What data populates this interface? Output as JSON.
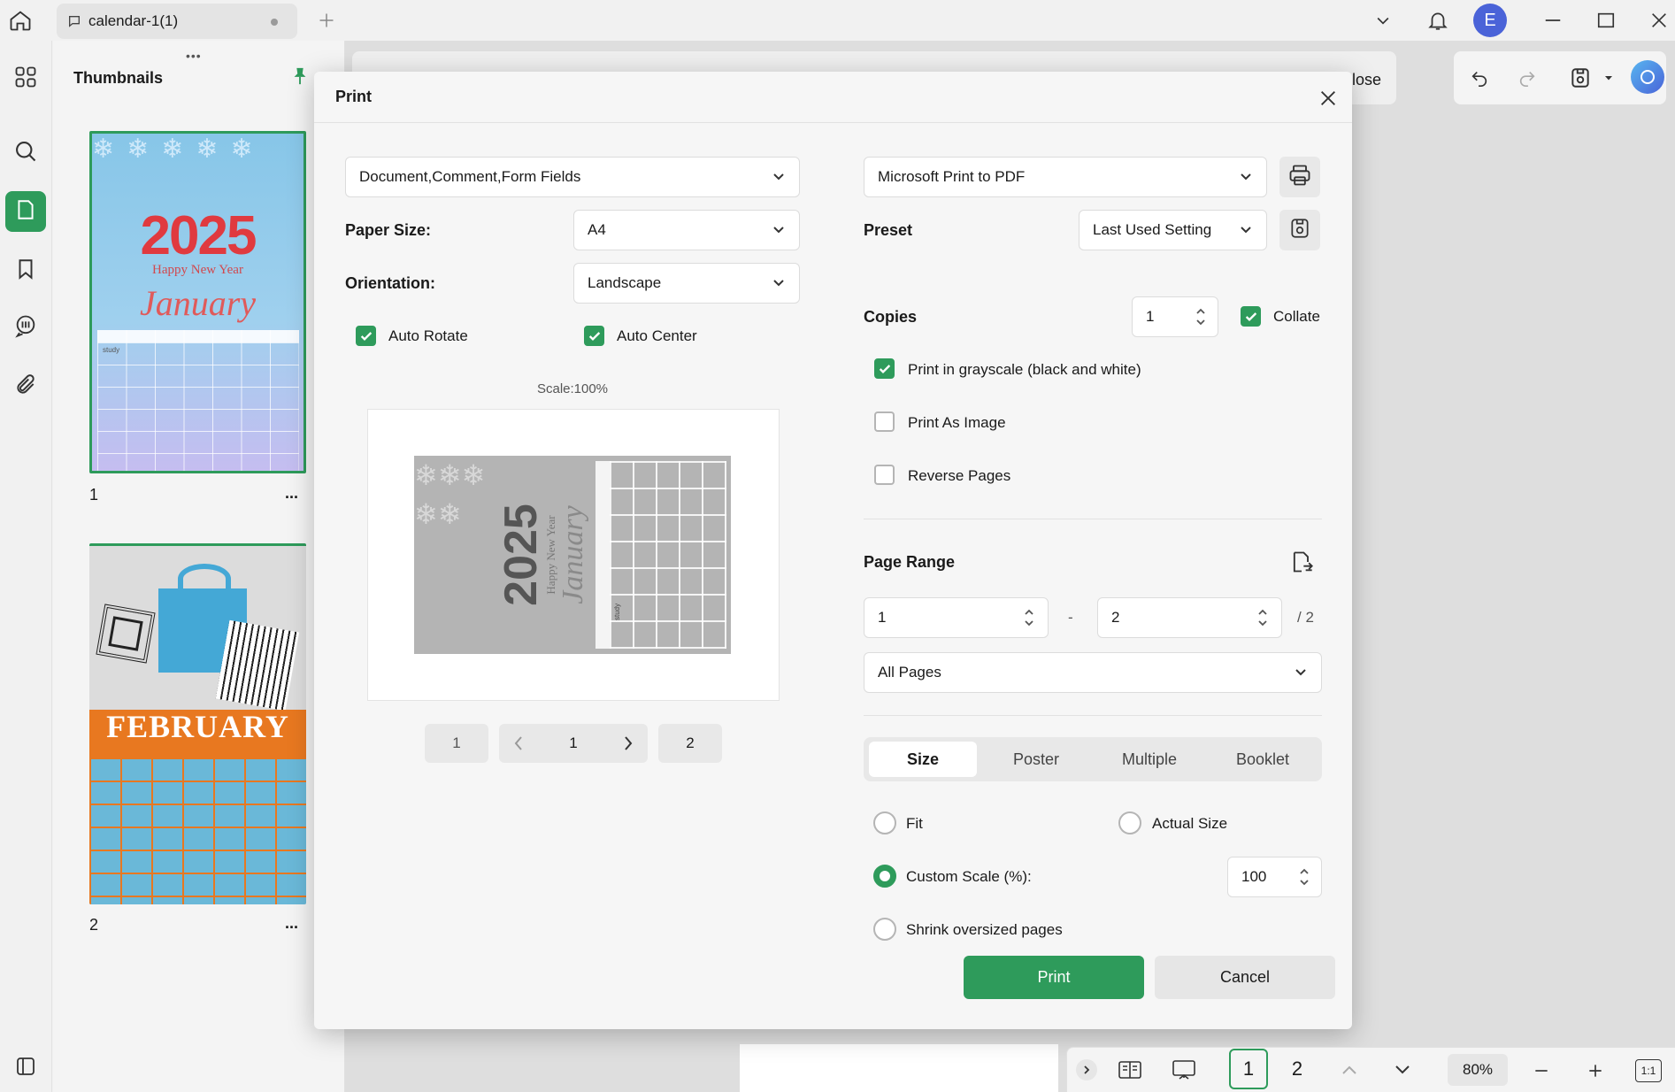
{
  "tab": {
    "title": "calendar-1(1)"
  },
  "user": {
    "avatar_letter": "E"
  },
  "thumbnails": {
    "title": "Thumbnails",
    "pages": [
      {
        "number": "1",
        "year": "2025",
        "greeting": "Happy New Year",
        "month": "January",
        "note": "study"
      },
      {
        "number": "2",
        "month": "FEBRUARY"
      }
    ],
    "more_label": "..."
  },
  "toolbar": {
    "close_partial": "lose"
  },
  "dialog": {
    "title": "Print",
    "content_select": "Document,Comment,Form Fields",
    "printer_select": "Microsoft Print to PDF",
    "paper_size": {
      "label": "Paper Size:",
      "value": "A4"
    },
    "orientation": {
      "label": "Orientation:",
      "value": "Landscape"
    },
    "auto_rotate": {
      "label": "Auto Rotate",
      "checked": true
    },
    "auto_center": {
      "label": "Auto Center",
      "checked": true
    },
    "scale_label": "Scale:100%",
    "preview": {
      "year": "2025",
      "greeting": "Happy New Year",
      "month": "January",
      "note": "study"
    },
    "pager": {
      "first": "1",
      "current": "1",
      "last": "2"
    },
    "preset": {
      "label": "Preset",
      "value": "Last Used Setting"
    },
    "copies": {
      "label": "Copies",
      "value": "1",
      "collate_label": "Collate",
      "collate_checked": true
    },
    "grayscale": {
      "label": "Print in grayscale (black and white)",
      "checked": true
    },
    "print_as_image": {
      "label": "Print As Image",
      "checked": false
    },
    "reverse_pages": {
      "label": "Reverse Pages",
      "checked": false
    },
    "page_range": {
      "label": "Page Range",
      "from": "1",
      "separator": "-",
      "to": "2",
      "total": "/ 2",
      "select": "All Pages"
    },
    "tabs": [
      "Size",
      "Poster",
      "Multiple",
      "Booklet"
    ],
    "active_tab": "Size",
    "size_options": {
      "fit": "Fit",
      "actual": "Actual Size",
      "custom": "Custom Scale (%):",
      "custom_value": "100",
      "shrink": "Shrink oversized pages",
      "selected": "custom"
    },
    "print_button": "Print",
    "cancel_button": "Cancel"
  },
  "statusbar": {
    "page1": "1",
    "page2": "2",
    "zoom": "80%",
    "fit_label": "1:1"
  },
  "colors": {
    "accent": "#2e9b5b",
    "avatar": "#4a63d8"
  }
}
